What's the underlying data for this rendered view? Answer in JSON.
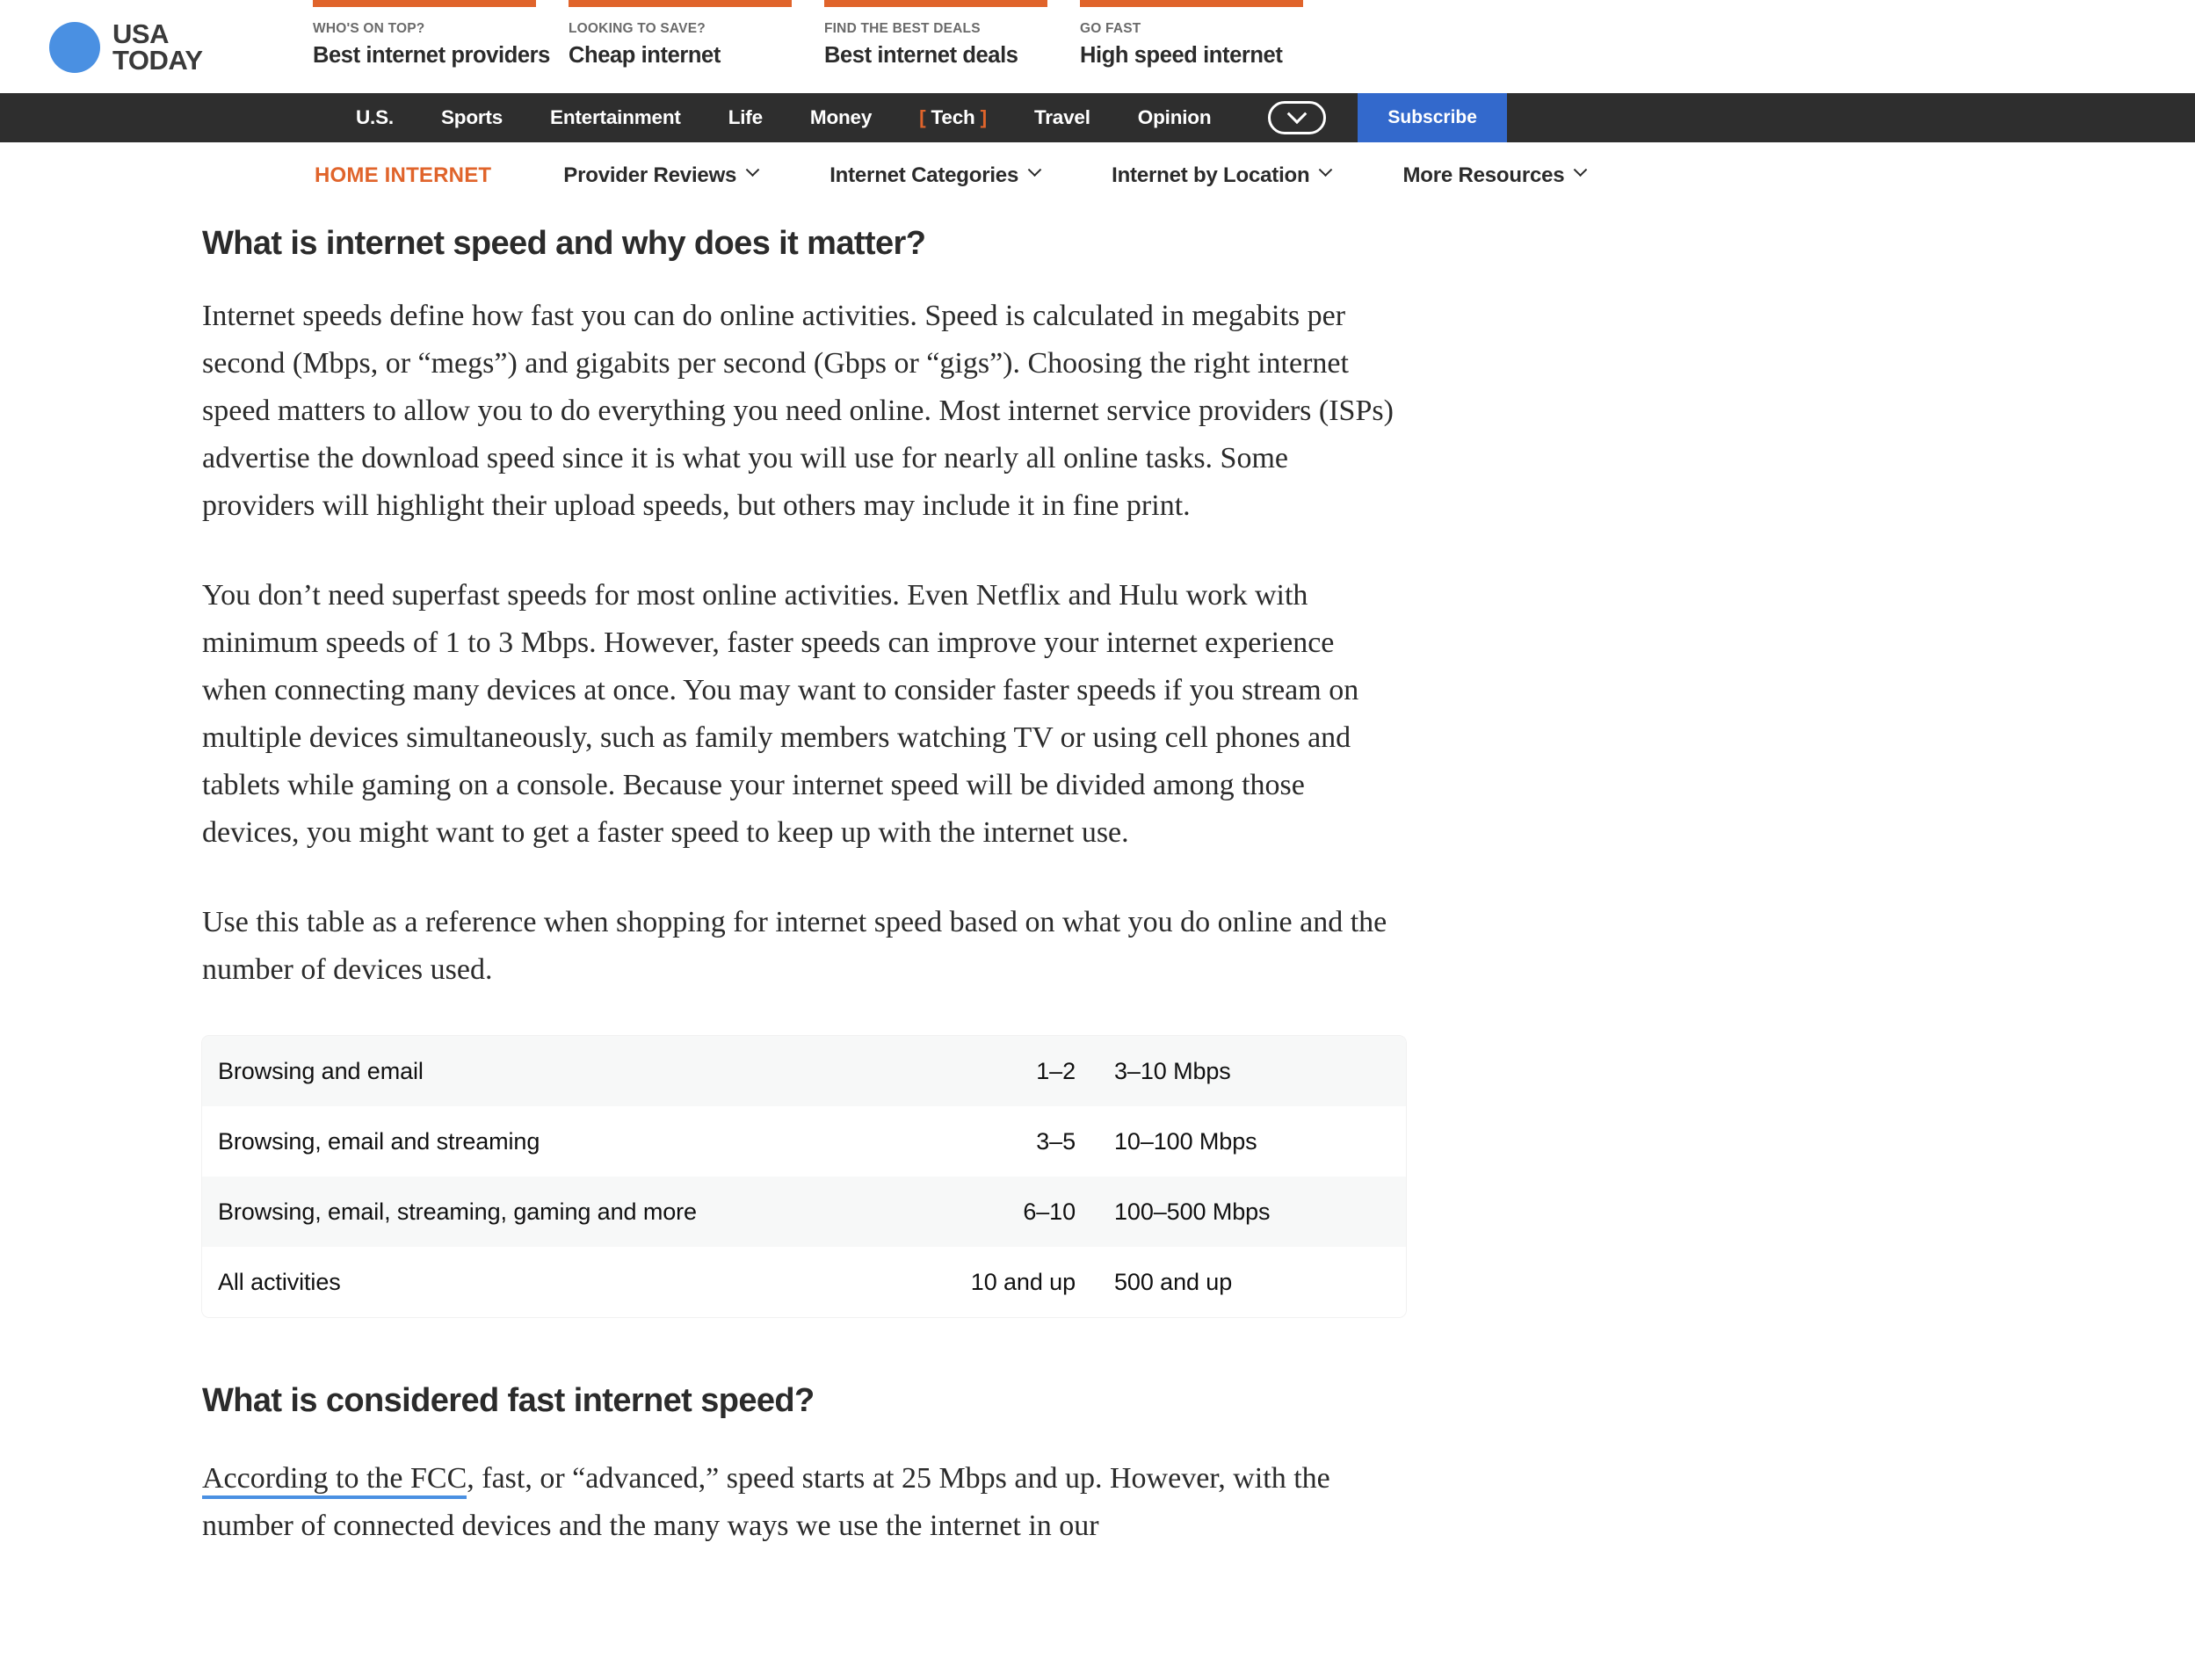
{
  "brand": {
    "logo_line1": "USA",
    "logo_line2": "TODAY",
    "logo_dot_color": "#4A90E2",
    "accent_color": "#E0642B",
    "nav_bg_color": "#2E2E2E",
    "subscribe_color": "#3369CC"
  },
  "promo_cards": [
    {
      "kicker": "WHO'S ON TOP?",
      "title": "Best internet providers"
    },
    {
      "kicker": "LOOKING TO SAVE?",
      "title": "Cheap internet"
    },
    {
      "kicker": "FIND THE BEST DEALS",
      "title": "Best internet deals"
    },
    {
      "kicker": "GO FAST",
      "title": "High speed internet"
    }
  ],
  "primary_nav": {
    "items": [
      {
        "label": "U.S.",
        "active": false
      },
      {
        "label": "Sports",
        "active": false
      },
      {
        "label": "Entertainment",
        "active": false
      },
      {
        "label": "Life",
        "active": false
      },
      {
        "label": "Money",
        "active": false
      },
      {
        "label": "Tech",
        "active": true
      },
      {
        "label": "Travel",
        "active": false
      },
      {
        "label": "Opinion",
        "active": false
      }
    ],
    "bracket_open": "[",
    "bracket_close": "]",
    "expand_icon": "chevron-down-icon",
    "subscribe_label": "Subscribe"
  },
  "secondary_nav": {
    "brand_label": "HOME INTERNET",
    "items": [
      {
        "label": "Provider Reviews"
      },
      {
        "label": "Internet Categories"
      },
      {
        "label": "Internet by Location"
      },
      {
        "label": "More Resources"
      }
    ]
  },
  "article": {
    "heading_1": "What is internet speed and why does it matter?",
    "paragraph_1": "Internet speeds define how fast you can do online activities. Speed is calculated in megabits per second (Mbps, or “megs”) and gigabits per second (Gbps or “gigs”). Choosing the right internet speed matters to allow you to do everything you need online. Most internet service providers (ISPs) advertise the download speed since it is what you will use for nearly all online tasks. Some providers will highlight their upload speeds, but others may include it in fine print.",
    "paragraph_2": "You don’t need superfast speeds for most online activities. Even Netflix and Hulu work with minimum speeds of 1 to 3 Mbps. However, faster speeds can improve your internet experience when connecting many devices at once. You may want to consider faster speeds if you stream on multiple devices simultaneously, such as family members watching TV or using cell phones and tablets while gaming on a console. Because your internet speed will be divided among those devices, you might want to get a faster speed to keep up with the internet use.",
    "paragraph_3": "Use this table as a reference when shopping for internet speed based on what you do online and the number of devices used.",
    "heading_2": "What is considered fast internet speed?",
    "paragraph_4_link": "According to the FCC",
    "paragraph_4_rest": ", fast, or “advanced,” speed starts at 25 Mbps and up. However, with the number of connected devices and the many ways we use the internet in our"
  },
  "speed_table": {
    "rows": [
      {
        "activity": "Browsing and email",
        "devices": "1–2",
        "speed": "3–10 Mbps"
      },
      {
        "activity": "Browsing, email and streaming",
        "devices": "3–5",
        "speed": "10–100 Mbps"
      },
      {
        "activity": "Browsing, email, streaming, gaming and more",
        "devices": "6–10",
        "speed": "100–500 Mbps"
      },
      {
        "activity": "All activities",
        "devices": "10 and up",
        "speed": "500 and up"
      }
    ]
  }
}
